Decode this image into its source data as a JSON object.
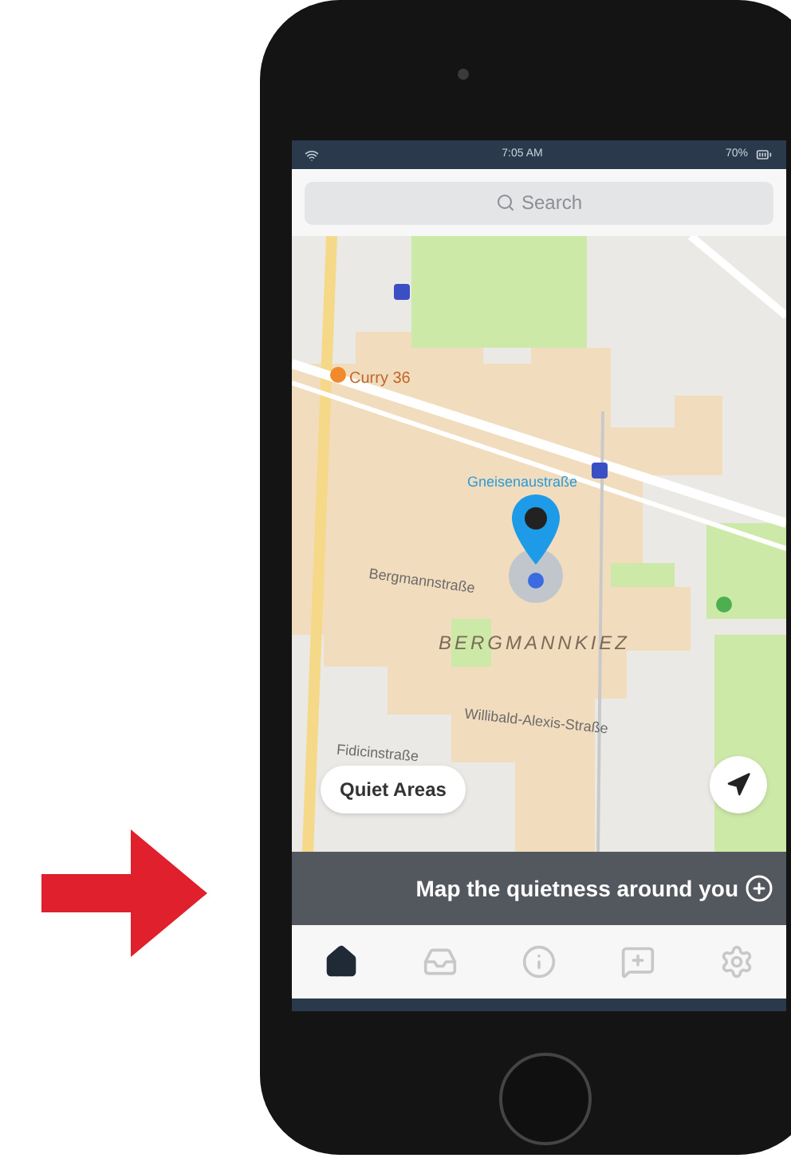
{
  "status_bar": {
    "time": "7:05 AM",
    "battery": "70%"
  },
  "search": {
    "placeholder": "Search"
  },
  "map": {
    "labels": [
      {
        "text": "Curry 36",
        "kind": "poi"
      },
      {
        "text": "Gneisenaustraße",
        "kind": "station"
      },
      {
        "text": "Bergmannstraße",
        "kind": "street"
      },
      {
        "text": "BERGMANNKIEZ",
        "kind": "district"
      },
      {
        "text": "Willibald-Alexis-Straße",
        "kind": "street"
      },
      {
        "text": "Fidicinstraße",
        "kind": "street"
      }
    ]
  },
  "quiet_areas_button": "Quiet Areas",
  "banner": {
    "text": "Map the quietness around you"
  },
  "tab_bar": [
    {
      "kind": "home",
      "selected": true
    },
    {
      "kind": "inbox",
      "selected": false
    },
    {
      "kind": "info",
      "selected": false
    },
    {
      "kind": "chat",
      "selected": false
    },
    {
      "kind": "settings",
      "selected": false
    }
  ]
}
